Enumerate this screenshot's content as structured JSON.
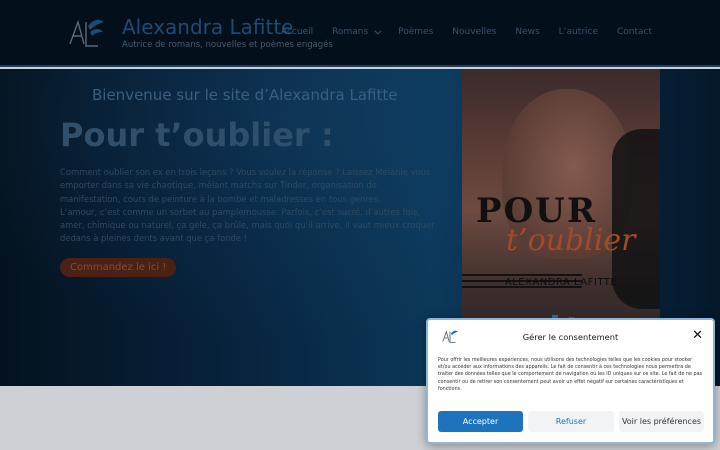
{
  "header": {
    "site_title": "Alexandra Lafitte",
    "tagline": "Autrice de romans, nouvelles et poèmes engagés",
    "logo_text": "AL",
    "nav": [
      {
        "label": "Accueil"
      },
      {
        "label": "Romans"
      },
      {
        "label": "Poèmes"
      },
      {
        "label": "Nouvelles"
      },
      {
        "label": "News"
      },
      {
        "label": "L’autrice"
      },
      {
        "label": "Contact"
      }
    ]
  },
  "hero": {
    "welcome": "Bienvenue sur le site d’Alexandra Lafitte",
    "title": "Pour t’oublier :",
    "description_1": "Comment oublier son ex en trois leçons ? Vous voulez la réponse ? Laissez Mélanie vous emporter dans sa vie chaotique, mêlant matchs sur Tinder, organisation de manifestation, cours de peinture à la bombe et maladresses en tous genres.",
    "description_2": "L’amour, c’est comme un sorbet au pamplemousse. Parfois, c’est sucré, d’autres fois, amer, chimique ou naturel, ça gèle, ça brûle, mais quoi qu’il arrive, il vaut mieux croquer dedans à pleines dents avant que ça fonde !",
    "cta_label": "Commandez le ici !"
  },
  "cover": {
    "word1": "POUR",
    "word2": "t’oublier",
    "author": "ALEXANDRA LAFITTE"
  },
  "consent": {
    "title": "Gérer le consentement",
    "close_label": "✕",
    "text": "Pour offrir les meilleures expériences, nous utilisons des technologies telles que les cookies pour stocker et/ou accéder aux informations des appareils. Le fait de consentir à ces technologies nous permettra de traiter des données telles que le comportement de navigation ou les ID uniques sur ce site. Le fait de ne pas consentir ou de retirer son consentement peut avoir un effet négatif sur certaines caractéristiques et fonctions.",
    "accept_label": "Accepter",
    "refuse_label": "Refuser",
    "prefs_label": "Voir les préférences"
  },
  "colors": {
    "accent": "#1e73be",
    "header_bg": "#03101c",
    "cta_bg": "#4b2114"
  }
}
